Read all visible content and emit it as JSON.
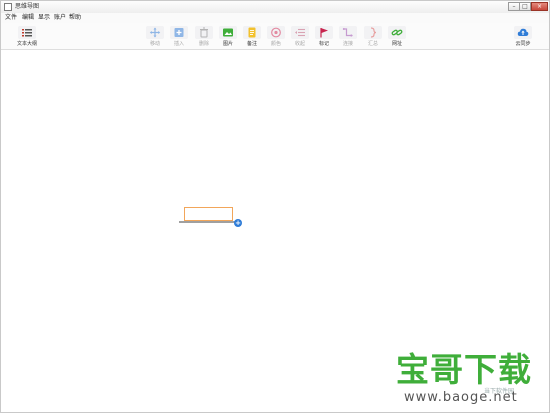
{
  "window": {
    "title": "思维导图"
  },
  "menu": [
    "文件",
    "编辑",
    "显示",
    "账户",
    "帮助"
  ],
  "toolbar": {
    "outline_label": "文本大纲",
    "move_label": "移动",
    "insert_label": "插入",
    "delete_label": "删除",
    "image_label": "图片",
    "note_label": "备注",
    "color_label": "颜色",
    "collapse_label": "收起",
    "marker_label": "标记",
    "connect_label": "连接",
    "summary_label": "汇总",
    "link_label": "网址",
    "cloud_label": "云同步"
  },
  "canvas": {
    "add_symbol": "+"
  },
  "watermark": {
    "main": "宝哥下载",
    "sub": "当下软件园",
    "url": "www.baoge.net"
  },
  "colors": {
    "accent": "#2f7cd7",
    "node_border": "#f2a65a",
    "watermark": "#3fae3a"
  }
}
